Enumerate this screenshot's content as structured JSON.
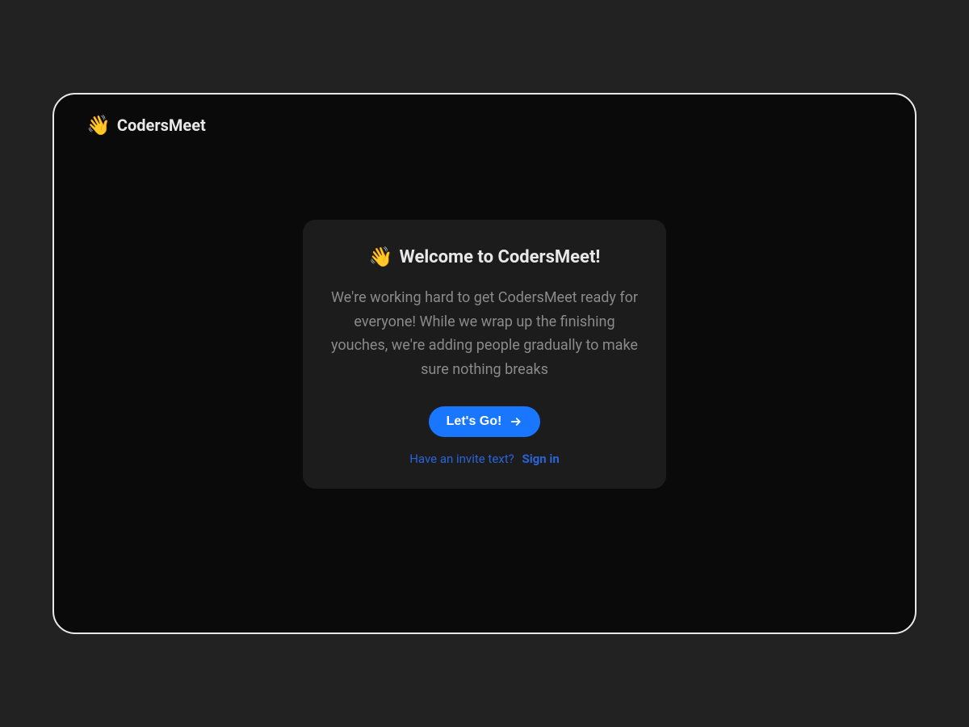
{
  "logo": {
    "icon": "👋",
    "text": "CodersMeet"
  },
  "card": {
    "heading_icon": "👋",
    "heading_text": "Welcome to CodersMeet!",
    "body": "We're working hard to get CodersMeet ready for everyone! While we wrap up the finishing youches, we're adding people gradually to make sure nothing breaks",
    "cta_label": "Let's Go!",
    "invite_question": "Have an invite text?",
    "signin_label": "Sign in"
  }
}
